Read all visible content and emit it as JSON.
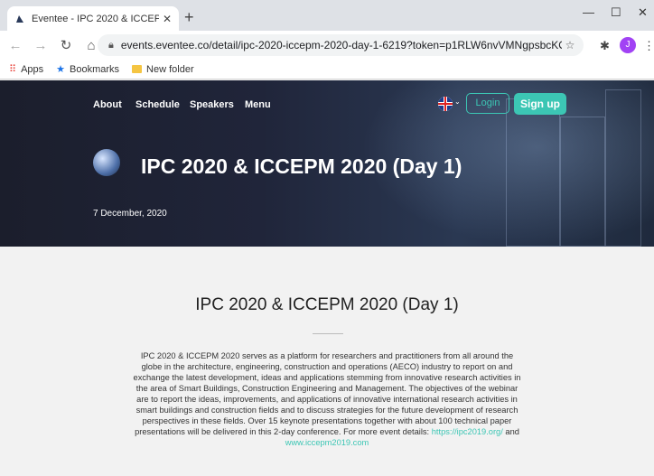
{
  "browser": {
    "tab_title": "Eventee - IPC 2020 & ICCEPM 20",
    "url": "events.eventee.co/detail/ipc-2020-iccepm-2020-day-1-6219?token=p1RLW6nvVMNgpsbcKO4UYZ5r...",
    "profile_initial": "J",
    "bookmarks": [
      "Apps",
      "Bookmarks",
      "New folder"
    ]
  },
  "header": {
    "nav": [
      "About",
      "Schedule",
      "Speakers",
      "Menu"
    ],
    "login_label": "Login",
    "signup_label": "Sign up",
    "event_title": "IPC 2020 & ICCEPM 2020 (Day 1)",
    "event_date": "7 December, 2020"
  },
  "main": {
    "title": "IPC 2020 & ICCEPM 2020 (Day 1)",
    "description": "IPC 2020 & ICCEPM 2020 serves as a platform for researchers and practitioners from all around the globe in the architecture, engineering, construction and operations (AECO) industry to report on and exchange the latest development, ideas and applications stemming from innovative research activities in the area of Smart Buildings, Construction Engineering and Management. The objectives of the webinar are to report the ideas, improvements, and applications of innovative international research activities in smart buildings and construction fields and to discuss strategies for the future development of research perspectives in these fields. Over 15 keynote presentations together with about 100 technical paper presentations will be delivered in this 2-day conference. For more event details: ",
    "link1": "https://ipc2019.org/",
    "link_joiner": " and ",
    "link2": "www.iccepm2019.com"
  },
  "colors": {
    "accent": "#3cc6b4",
    "hero_bg": "#1b1e2c"
  }
}
